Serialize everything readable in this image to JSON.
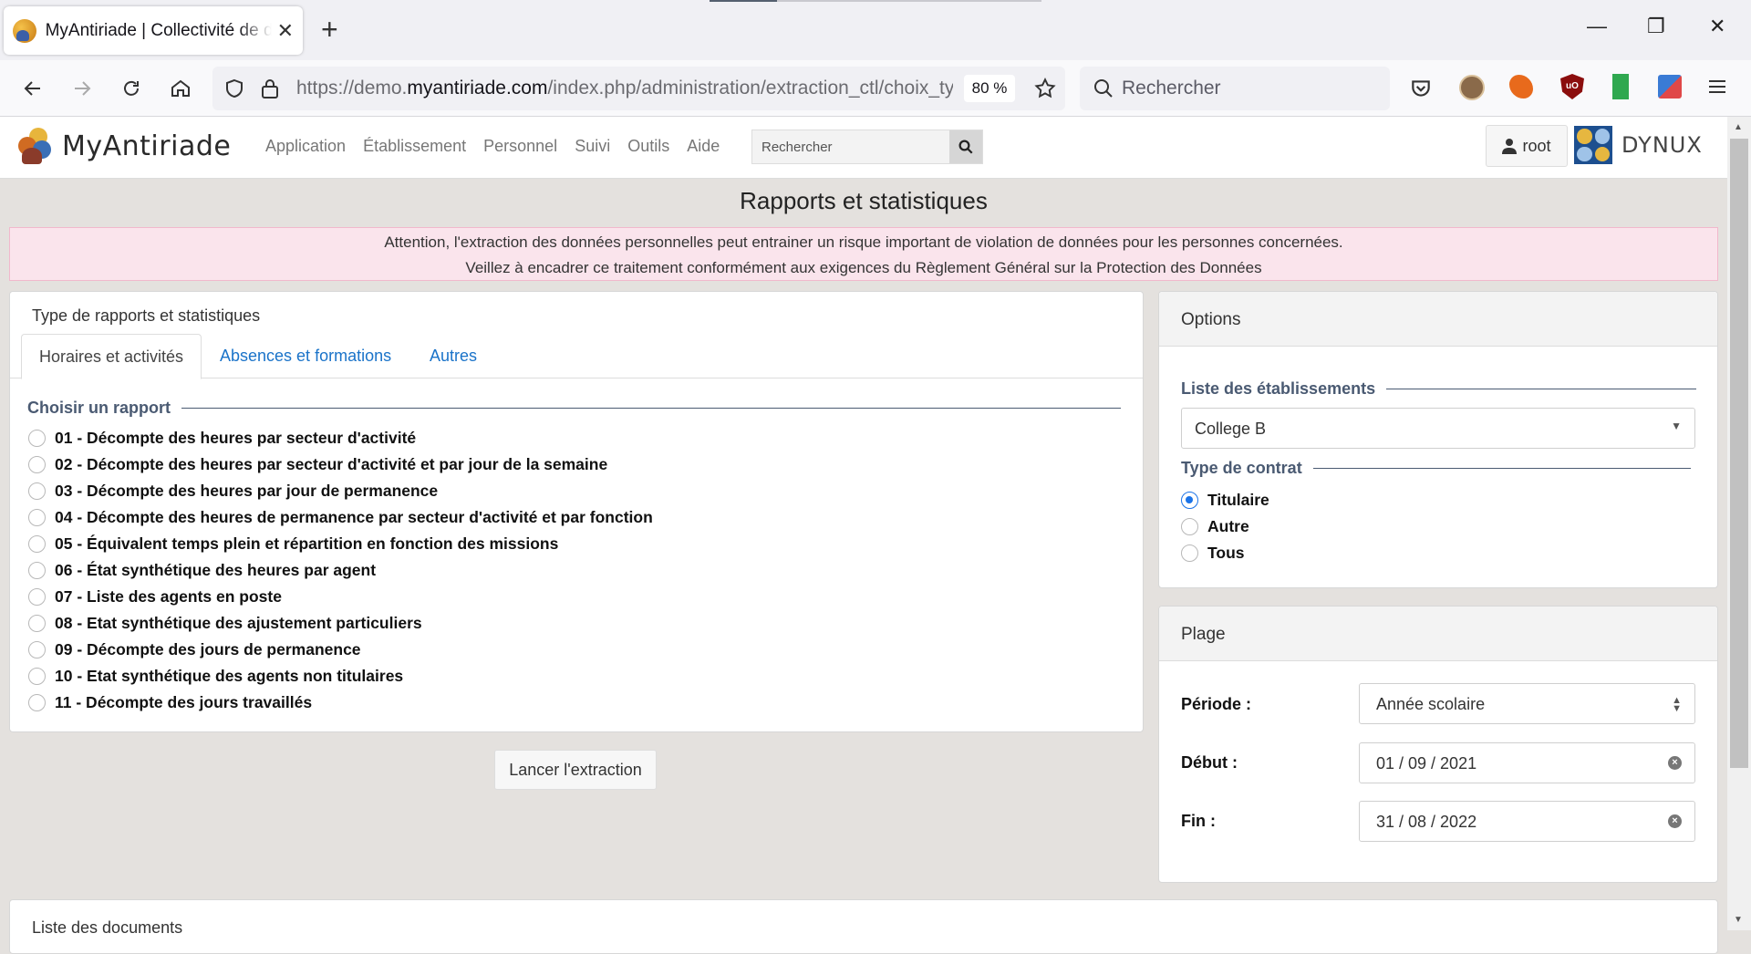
{
  "browser": {
    "tab_title": "MyAntiriade | Collectivité de démonstration",
    "url_prefix": "https://demo.",
    "url_domain": "myantiriade.com",
    "url_path": "/index.php/administration/extraction_ctl/choix_type",
    "zoom": "80 %",
    "search_placeholder": "Rechercher",
    "win_minimize": "—",
    "win_restore": "❐",
    "win_close": "✕"
  },
  "app": {
    "logo_text": "MyAntiriade",
    "menu": [
      "Application",
      "Établissement",
      "Personnel",
      "Suivi",
      "Outils",
      "Aide"
    ],
    "search_placeholder": "Rechercher",
    "user": "root",
    "partner": "DYNUX"
  },
  "page": {
    "title": "Rapports et statistiques",
    "alert_line1": "Attention, l'extraction des données personnelles peut entrainer un risque important de violation de données pour les personnes concernées.",
    "alert_line2": "Veillez à encadrer ce traitement conformément aux exigences du Règlement Général sur la Protection des Données"
  },
  "reports": {
    "card_title": "Type de rapports et statistiques",
    "tabs": [
      "Horaires et activités",
      "Absences et formations",
      "Autres"
    ],
    "active_tab": 0,
    "legend": "Choisir un rapport",
    "items": [
      "01 - Décompte des heures par secteur d'activité",
      "02 - Décompte des heures par secteur d'activité et par jour de la semaine",
      "03 - Décompte des heures par jour de permanence",
      "04 - Décompte des heures de permanence par secteur d'activité et par fonction",
      "05 - Équivalent temps plein et répartition en fonction des missions",
      "06 - État synthétique des heures par agent",
      "07 - Liste des agents en poste",
      "08 - Etat synthétique des ajustement particuliers",
      "09 - Décompte des jours de permanence",
      "10 - Etat synthétique des agents non titulaires",
      "11 - Décompte des jours travaillés"
    ],
    "launch_label": "Lancer l'extraction"
  },
  "options": {
    "title": "Options",
    "etab_legend": "Liste des établissements",
    "etab_value": "College B",
    "contrat_legend": "Type de contrat",
    "contrat_options": [
      "Titulaire",
      "Autre",
      "Tous"
    ],
    "contrat_selected": 0
  },
  "plage": {
    "title": "Plage",
    "periode_label": "Période :",
    "periode_value": "Année scolaire",
    "debut_label": "Début :",
    "debut_value": "01 / 09 / 2021",
    "fin_label": "Fin :",
    "fin_value": "31 / 08 / 2022"
  },
  "documents": {
    "title": "Liste des documents"
  }
}
